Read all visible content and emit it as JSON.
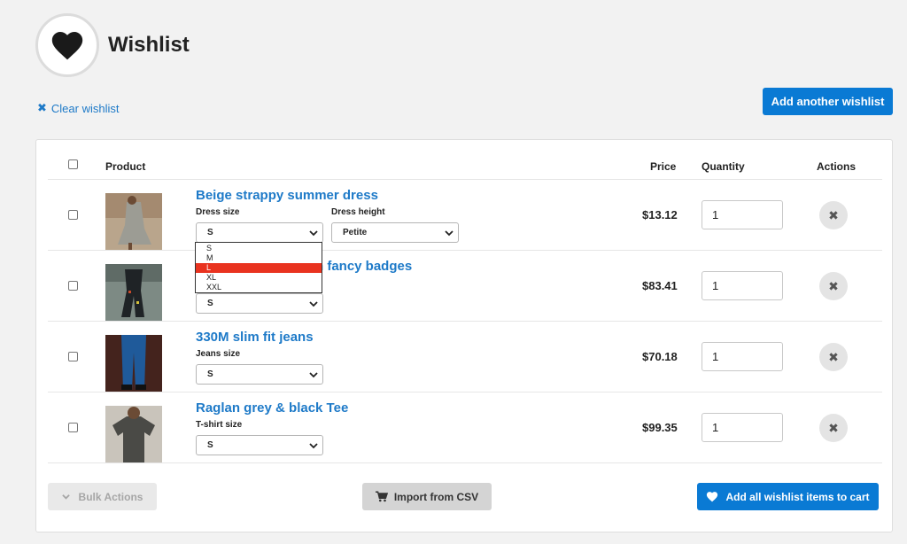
{
  "header": {
    "title": "Wishlist",
    "icon": "heart-icon"
  },
  "toolbar": {
    "clear_label": "Clear wishlist",
    "add_wishlist_label": "Add another wishlist"
  },
  "table": {
    "columns": {
      "product": "Product",
      "price": "Price",
      "quantity": "Quantity",
      "actions": "Actions"
    },
    "rows": [
      {
        "name": "Beige strappy summer dress",
        "variant1_label": "Dress size",
        "variant1_value": "S",
        "variant2_label": "Dress height",
        "variant2_value": "Petite",
        "price": "$13.12",
        "quantity": "1"
      },
      {
        "name": "th fancy badges",
        "variant1_value": "S",
        "price": "$83.41",
        "quantity": "1"
      },
      {
        "name": "330M slim fit jeans",
        "variant1_label": "Jeans size",
        "variant1_value": "S",
        "price": "$70.18",
        "quantity": "1"
      },
      {
        "name": "Raglan grey & black Tee",
        "variant1_label": "T-shirt size",
        "variant1_value": "S",
        "price": "$99.35",
        "quantity": "1"
      }
    ]
  },
  "size_dropdown": {
    "options": [
      "S",
      "M",
      "L",
      "XL",
      "XXL"
    ],
    "highlighted": "L"
  },
  "footer": {
    "bulk_label": "Bulk Actions",
    "import_label": "Import from CSV",
    "add_all_label": "Add all wishlist items to cart"
  },
  "colors": {
    "accent": "#0a7ad4",
    "link": "#1e7ac8",
    "highlight": "#e9331f"
  }
}
